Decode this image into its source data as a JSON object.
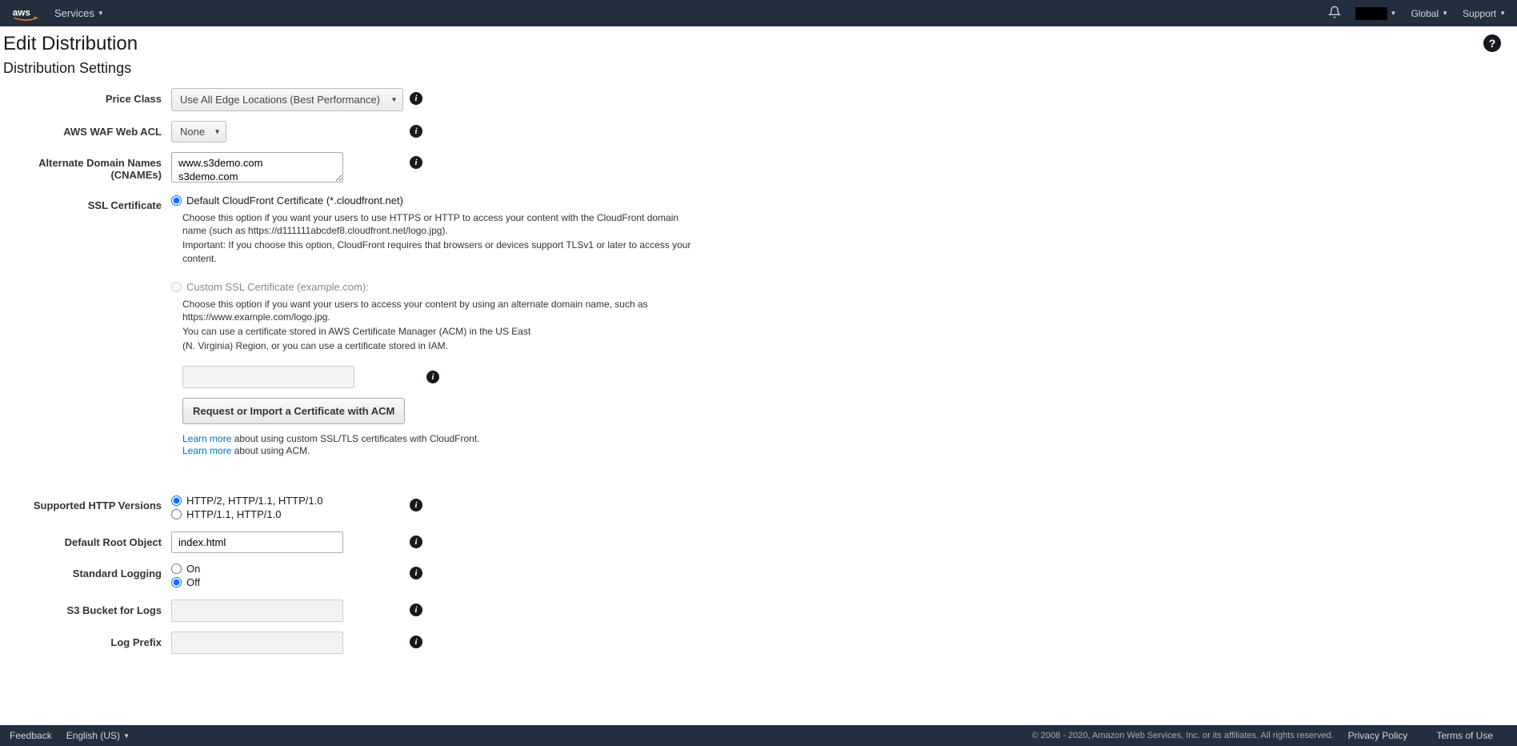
{
  "nav": {
    "services": "Services",
    "global": "Global",
    "support": "Support"
  },
  "page": {
    "title": "Edit Distribution",
    "section": "Distribution Settings"
  },
  "labels": {
    "price_class": "Price Class",
    "waf": "AWS WAF Web ACL",
    "cnames": "Alternate Domain Names",
    "cnames2": "(CNAMEs)",
    "ssl": "SSL Certificate",
    "http_versions": "Supported HTTP Versions",
    "root_object": "Default Root Object",
    "logging": "Standard Logging",
    "s3_bucket": "S3 Bucket for Logs",
    "log_prefix": "Log Prefix"
  },
  "values": {
    "price_class": "Use All Edge Locations (Best Performance)",
    "waf": "None",
    "cnames": "www.s3demo.com\ns3demo.com",
    "root_object": "index.html"
  },
  "ssl": {
    "default_label": "Default CloudFront Certificate (*.cloudfront.net)",
    "default_desc1": "Choose this option if you want your users to use HTTPS or HTTP to access your content with the CloudFront domain name (such as https://d111111abcdef8.cloudfront.net/logo.jpg).",
    "default_desc2": "Important: If you choose this option, CloudFront requires that browsers or devices support TLSv1 or later to access your content.",
    "custom_label": "Custom SSL Certificate (example.com):",
    "custom_desc1": "Choose this option if you want your users to access your content by using an alternate domain name, such as https://www.example.com/logo.jpg.",
    "custom_desc2": "You can use a certificate stored in AWS Certificate Manager (ACM) in the US East",
    "custom_desc3": "(N. Virginia) Region, or you can use a certificate stored in IAM.",
    "request_btn": "Request or Import a Certificate with ACM",
    "learn1_link": "Learn more",
    "learn1_text": " about using custom SSL/TLS certificates with CloudFront.",
    "learn2_link": "Learn more",
    "learn2_text": " about using ACM."
  },
  "http": {
    "opt1": "HTTP/2, HTTP/1.1, HTTP/1.0",
    "opt2": "HTTP/1.1, HTTP/1.0"
  },
  "logging": {
    "on": "On",
    "off": "Off"
  },
  "footer": {
    "feedback": "Feedback",
    "language": "English (US)",
    "copyright": "© 2008 - 2020, Amazon Web Services, Inc. or its affiliates. All rights reserved.",
    "privacy": "Privacy Policy",
    "terms": "Terms of Use"
  }
}
